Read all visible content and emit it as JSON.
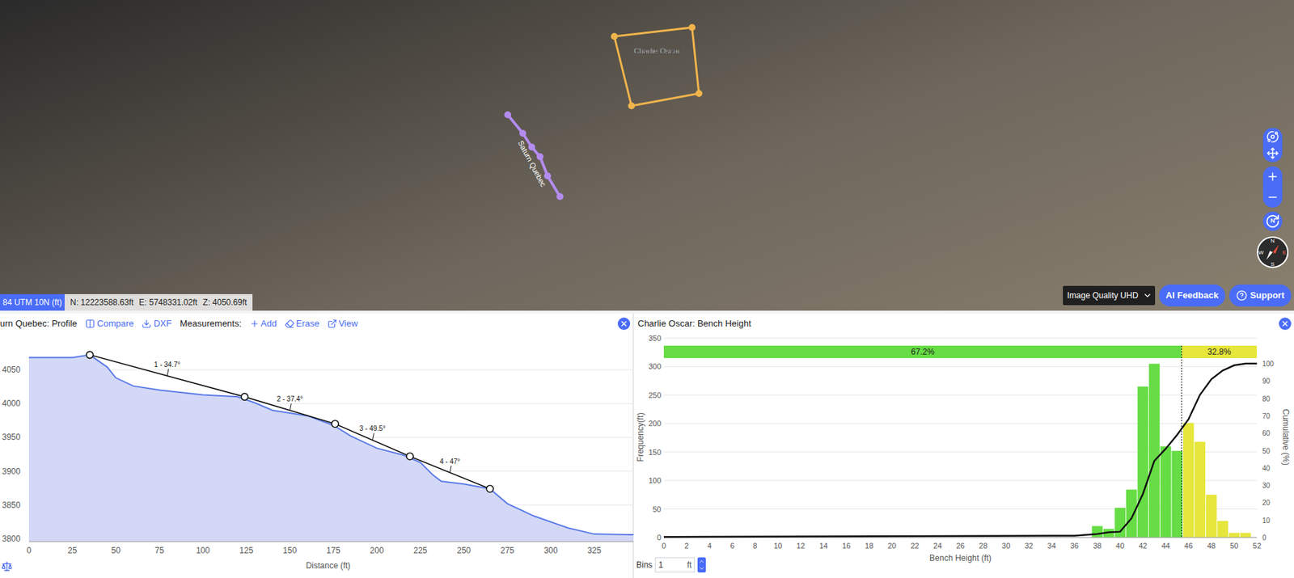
{
  "viewport": {
    "annotations": [
      {
        "kind": "polygon",
        "label": "Charlie Oscar",
        "color": "#f0b44c"
      },
      {
        "kind": "polyline",
        "label": "Saturn Quebec",
        "color": "#b48cf0"
      }
    ],
    "north_button": "N",
    "compass": {
      "n": "N",
      "e": "E",
      "s": "S",
      "w": "W"
    }
  },
  "status_bar": {
    "crs": "84 UTM 10N (ft)",
    "coords": [
      "N: 12223588.63ft",
      "E: 5748331.02ft",
      "Z: 4050.69ft"
    ],
    "quality": "Image Quality UHD",
    "buttons": [
      "AI Feedback",
      "Support"
    ]
  },
  "profile_panel": {
    "title": "urn Quebec: Profile",
    "actions": [
      "Compare",
      "DXF"
    ],
    "measurements_label": "Measurements:",
    "measurement_actions": [
      "Add",
      "Erase",
      "View"
    ],
    "chart": {
      "y_ticks": [
        "4050",
        "4000",
        "3950",
        "3900",
        "3850",
        "3800"
      ],
      "x_ticks": [
        "0",
        "25",
        "50",
        "75",
        "100",
        "125",
        "150",
        "175",
        "200",
        "225",
        "250",
        "275",
        "300",
        "325"
      ],
      "x_label": "Distance (ft)",
      "profile": {
        "distance": [
          0,
          25,
          35,
          45,
          50,
          60,
          75,
          100,
          120,
          130,
          140,
          160,
          175,
          185,
          200,
          215,
          225,
          232,
          237,
          250,
          265,
          275,
          290,
          310,
          325,
          345,
          348
        ],
        "elevation": [
          4068,
          4068,
          4072,
          4054,
          4038,
          4026,
          4020,
          4013,
          4010,
          4001,
          3990,
          3982,
          3968,
          3952,
          3934,
          3924,
          3913,
          3895,
          3885,
          3881,
          3874,
          3852,
          3834,
          3816,
          3807,
          3806,
          3806
        ]
      },
      "points": {
        "distance": [
          35,
          124,
          176,
          219,
          265
        ],
        "elevation": [
          4072,
          4010,
          3970,
          3922,
          3874
        ]
      },
      "measurements": [
        "1 - 34.7°",
        "2 - 37.4°",
        "3 - 49.5°",
        "4 - 47°"
      ]
    }
  },
  "bench_panel": {
    "title": "Charlie Oscar: Bench Height",
    "chart": {
      "y_label": "Frequency(ft)",
      "y_ticks": [
        "0",
        "50",
        "100",
        "150",
        "200",
        "250",
        "300",
        "350"
      ],
      "x_label": "Bench Height (ft)",
      "x_ticks": [
        "0",
        "2",
        "4",
        "6",
        "8",
        "10",
        "12",
        "14",
        "16",
        "18",
        "20",
        "22",
        "24",
        "26",
        "28",
        "30",
        "32",
        "34",
        "36",
        "38",
        "40",
        "42",
        "44",
        "46",
        "48",
        "50",
        "52"
      ],
      "y2_label": "Cumulative (%)",
      "y2_ticks": [
        "0",
        "10",
        "20",
        "30",
        "40",
        "50",
        "60",
        "70",
        "80",
        "90",
        "100"
      ],
      "threshold": 45.4,
      "split": [
        {
          "label": "67.2%",
          "color": "#66dd44"
        },
        {
          "label": "32.8%",
          "color": "#e6e63c"
        }
      ],
      "series": [
        {
          "name": "within",
          "color": "#66dd44",
          "start": 38,
          "values": [
            20,
            15,
            52,
            84,
            265,
            305,
            160,
            152
          ]
        },
        {
          "name": "above",
          "color": "#e6e63c",
          "start": 46,
          "values": [
            201,
            168,
            75,
            29,
            8,
            8
          ]
        }
      ],
      "cumulative": {
        "x": [
          0,
          36,
          38,
          39,
          40,
          41,
          42,
          43,
          44,
          45,
          46,
          47,
          48,
          49,
          50,
          51,
          52
        ],
        "values": [
          0.3,
          1,
          2,
          3,
          3.3,
          11,
          25,
          44,
          51,
          59,
          68,
          82,
          91,
          96,
          99,
          100,
          100
        ]
      }
    },
    "bins": {
      "label": "Bins",
      "value": "1",
      "unit": "ft"
    }
  }
}
